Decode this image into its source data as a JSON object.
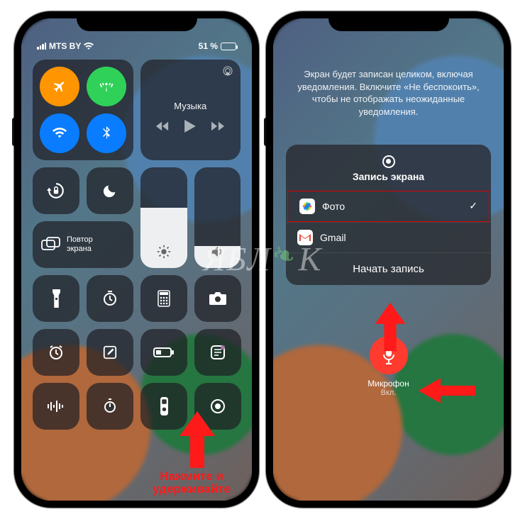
{
  "statusbar": {
    "carrier": "MTS BY",
    "battery_pct": "51 %"
  },
  "left": {
    "music_label": "Музыка",
    "screen_mirror": "Повтор\nэкрана",
    "annotation": "Нажмите и\nудерживайте"
  },
  "right": {
    "info": "Экран будет записан целиком, включая уведомления. Включите «Не беспокоить», чтобы не отображать неожиданные уведомления.",
    "sheet_title": "Запись экрана",
    "apps": [
      {
        "name": "Фото",
        "selected": true
      },
      {
        "name": "Gmail",
        "selected": false
      }
    ],
    "start": "Начать запись",
    "mic_label": "Микрофон",
    "mic_state": "Вкл."
  },
  "watermark": "ЯБЛЫК"
}
